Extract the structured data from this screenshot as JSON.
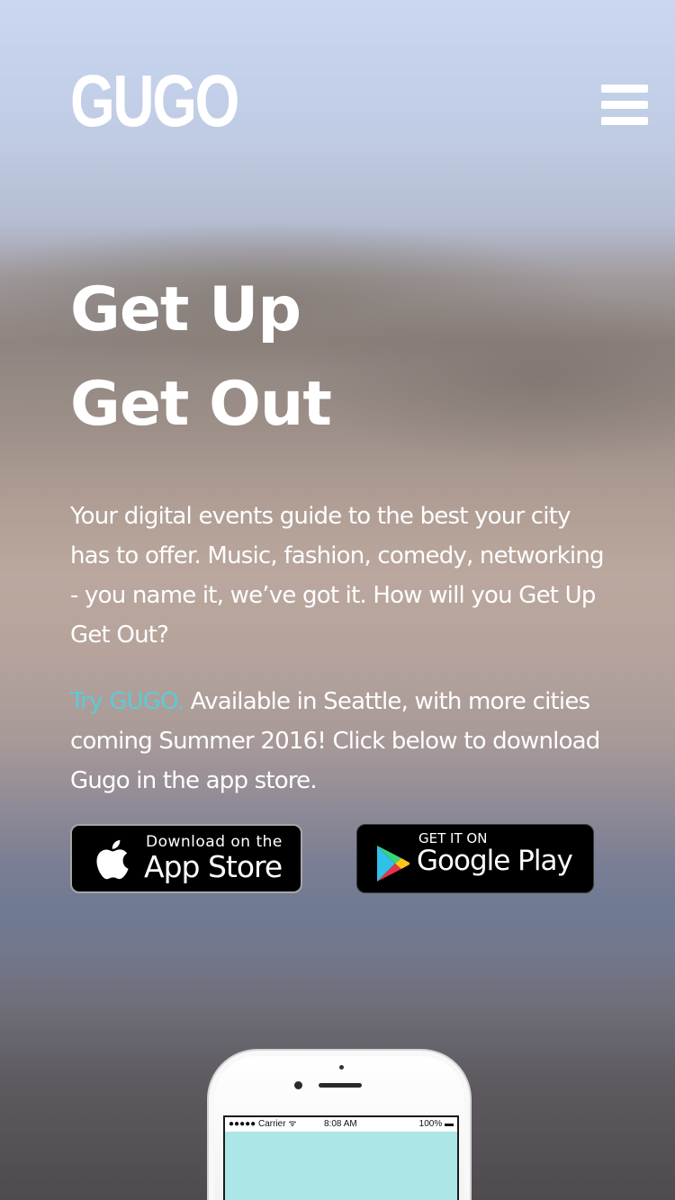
{
  "header": {
    "logo": "GUGO",
    "menu_icon": "hamburger-menu-icon"
  },
  "hero": {
    "headline_line1": "Get Up",
    "headline_line2": "Get Out",
    "description": "Your digital events guide to the best your city has to offer. Music, fashion, comedy, networking - you name it, we’ve got it. How will you Get Up Get Out?",
    "cta_link": "Try GUGO.",
    "cta_text": " Available in Seattle, with more cities coming Summer 2016! Click below to download Gugo in the app store."
  },
  "badges": {
    "apple": {
      "small": "Download on the",
      "big": "App Store",
      "icon": "apple-icon"
    },
    "google": {
      "small": "GET IT ON",
      "big": "Google Play",
      "icon": "google-play-icon"
    }
  },
  "phone": {
    "carrier": "●●●●● Carrier ᯤ",
    "time": "8:08 AM",
    "battery": "100% ▬"
  },
  "colors": {
    "accent": "#5ccbd6",
    "text": "#ffffff",
    "badge_bg": "#000000",
    "phone_screen": "#ade6e6"
  }
}
